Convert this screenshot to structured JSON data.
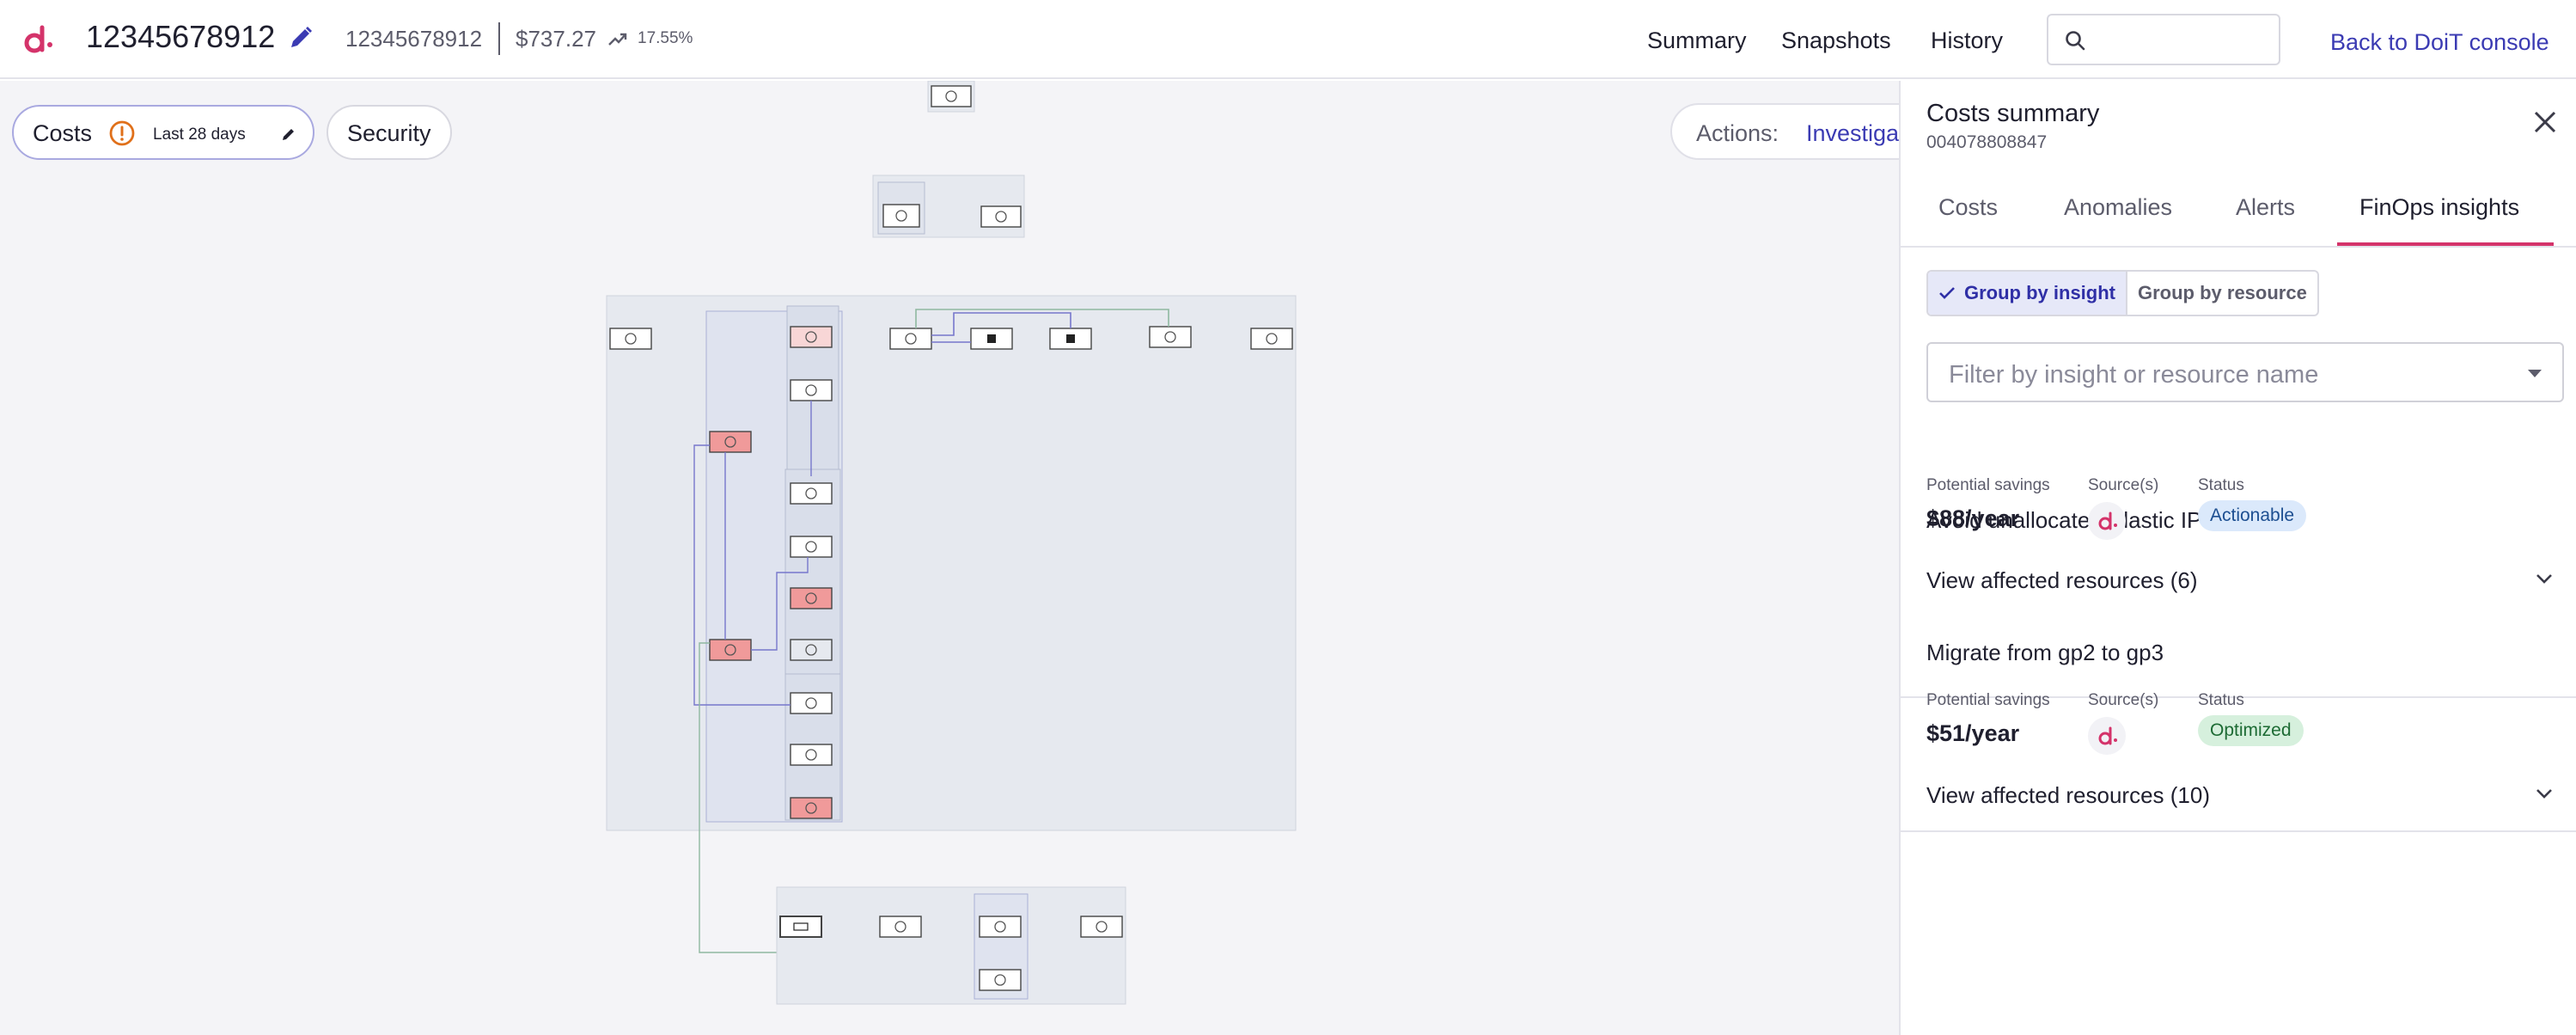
{
  "header": {
    "account_title": "12345678912",
    "account_id": "12345678912",
    "amount": "$737.27",
    "trend_pct": "17.55%",
    "nav": [
      "Summary",
      "Snapshots",
      "History"
    ],
    "search_placeholder": "",
    "back_link": "Back to DoiT console"
  },
  "canvas": {
    "costs_chip": {
      "label": "Costs",
      "range": "Last 28 days"
    },
    "security_chip": {
      "label": "Security"
    },
    "actions": {
      "label": "Actions:",
      "value": "Investiga"
    }
  },
  "panel": {
    "title": "Costs summary",
    "subtitle": "004078808847",
    "tabs": [
      "Costs",
      "Anomalies",
      "Alerts",
      "FinOps insights"
    ],
    "active_tab": "FinOps insights",
    "group_toggle": {
      "selected": "Group by insight",
      "other": "Group by resource"
    },
    "filter_placeholder": "Filter by insight or resource name",
    "labels": {
      "savings": "Potential savings",
      "sources": "Source(s)",
      "status": "Status"
    },
    "insights": [
      {
        "title": "Avoid unallocated Elastic IPs",
        "savings": "$88/year",
        "status": "Actionable",
        "view": "View affected resources (6)"
      },
      {
        "title": "Migrate from gp2 to gp3",
        "savings": "$51/year",
        "status": "Optimized",
        "view": "View affected resources (10)"
      }
    ]
  },
  "colors": {
    "accent": "#3b3bb3",
    "brand": "#d4336a",
    "alert_node": "#f09a9a",
    "group_bg": "#e6e9ef"
  }
}
